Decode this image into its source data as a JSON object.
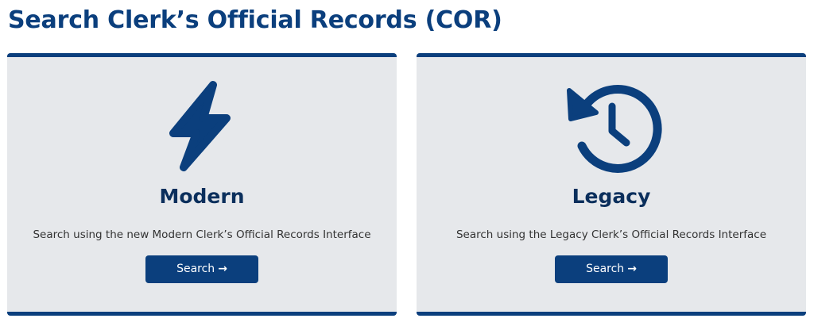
{
  "page": {
    "title": "Search Clerk’s Official Records (COR)"
  },
  "colors": {
    "brand_navy": "#0b3f7d",
    "card_background": "#e6e8eb",
    "title_text": "#0b2f5c",
    "body_text": "#333333"
  },
  "cards": [
    {
      "icon": "lightning-bolt-icon",
      "title": "Modern",
      "description": "Search using the new Modern Clerk’s Official Records Interface",
      "button_label": "Search",
      "button_icon": "arrow-right-icon",
      "button_arrow": "→"
    },
    {
      "icon": "history-clock-icon",
      "title": "Legacy",
      "description": "Search using the Legacy Clerk’s Official Records Interface",
      "button_label": "Search",
      "button_icon": "arrow-right-icon",
      "button_arrow": "→"
    }
  ]
}
